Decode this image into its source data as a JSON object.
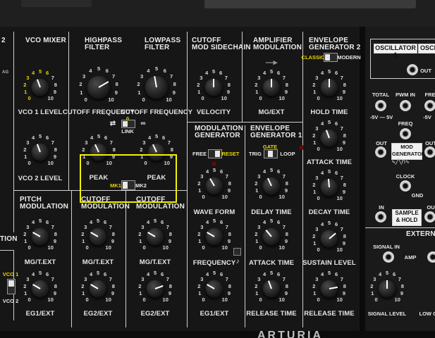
{
  "sections": {
    "vco_mixer": "VCO MIXER",
    "highpass": "HIGHPASS\nFILTER",
    "lowpass": "LOWPASS\nFILTER",
    "cutoff_mod": "CUTOFF\nMOD SIDECHAIN",
    "amp_mod": "AMPLIFIER\nMODULATION",
    "env2": "ENVELOPE\nGENERATOR 2",
    "mod_gen": "MODULATION\nGENERATOR",
    "env1": "ENVELOPE\nGENERATOR 1",
    "pitch_mod": "PITCH\nMODULATION",
    "cutoff_mod_hp": "CUTOFF\nMODULATION",
    "cutoff_mod_lp": "CUTOFF\nMODULATION",
    "partial_tion": "TION",
    "external": "EXTERNAL",
    "partial_2": "2"
  },
  "labels": {
    "vco1_level": "VCO 1 LEVEL",
    "vco2_level": "VCO 2 LEVEL",
    "hp_cutoff": "CUTOFF FREQUENCY",
    "lp_cutoff": "CUTOFF FREQUENCY",
    "velocity": "VELOCITY",
    "mg_ext_amp": "MG/EXT",
    "hold_time": "HOLD TIME",
    "attack_time_env2": "ATTACK TIME",
    "decay_time_env2": "DECAY TIME",
    "sustain_level": "SUSTAIN LEVEL",
    "release_time_env2": "RELEASE TIME",
    "hp_peak": "PEAK",
    "lp_peak": "PEAK",
    "link": "LINK",
    "mk1": "MK1",
    "mk2": "MK2",
    "free": "FREE",
    "reset": "RESET",
    "wave_form": "WAVE FORM",
    "frequency": "FREQUENCY",
    "trig": "TRIG",
    "gate": "GATE",
    "loop": "LOOP",
    "delay_time": "DELAY TIME",
    "attack_time_env1": "ATTACK TIME",
    "release_time_env1": "RELEASE TIME",
    "classic": "CLASSIC",
    "modern": "MODERN",
    "mg_t_ext_pitch": "MG/T.EXT",
    "mg_t_ext_hp": "MG/T.EXT",
    "mg_t_ext_lp": "MG/T.EXT",
    "eg1_ext_pitch": "EG1/EXT",
    "eg2_ext_hp": "EG2/EXT",
    "eg2_ext_lp": "EG2/EXT",
    "eg1_ext_modgen": "EG1/EXT",
    "vco1": "VCO 1",
    "vco2": "VCO 2",
    "oscillator1": "OSCILLATOR 1",
    "oscillator_partial": "OSCIL",
    "out": "OUT",
    "total": "TOTAL",
    "pwm_in": "PWM IN",
    "fre_partial": "FRE",
    "range": "-5V — 5V",
    "range_partial": "-5V",
    "freq": "FREQ",
    "out2": "OUT",
    "mod_generator": "MOD\nGENERATOR",
    "out3": "OUT",
    "clock": "CLOCK",
    "gnd": "GND",
    "in": "IN",
    "sample_hold": "SAMPLE\n& HOLD",
    "out4": "OU",
    "signal_in": "SIGNAL IN",
    "amp": "AMP",
    "signal_level": "SIGNAL LEVEL",
    "low_partial": "LOW C",
    "brand_partial": "ARTURIA",
    "ag_partial": "AG"
  },
  "scale": {
    "n0": "0",
    "n1": "1",
    "n2": "2",
    "n3": "3",
    "n4": "4",
    "n5": "5",
    "n6": "6",
    "n7": "7",
    "n8": "8",
    "n9": "9",
    "n10": "10"
  },
  "selection": {
    "color": "#f2f200"
  }
}
